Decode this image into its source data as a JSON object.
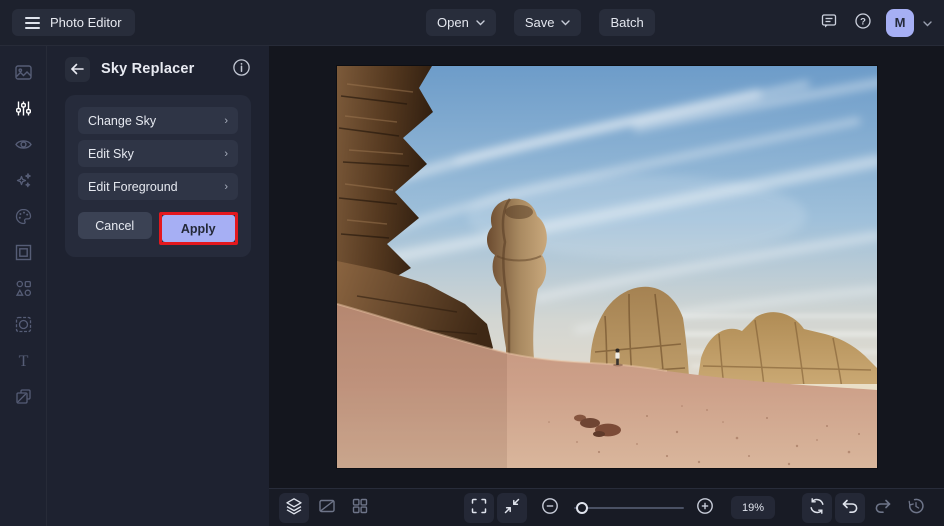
{
  "colors": {
    "accent": "#a6aff4",
    "annotation_red": "#e3181e",
    "topbar_bg": "#1d212d",
    "panel_bg": "#1e2230",
    "canvas_bg": "#14161e"
  },
  "topbar": {
    "app_button": "Photo Editor",
    "open_label": "Open",
    "save_label": "Save",
    "batch_label": "Batch",
    "avatar_initial": "M",
    "icons": [
      "hamburger-icon",
      "chat-feedback-icon",
      "help-icon",
      "chevron-down-icon"
    ]
  },
  "sidebar": {
    "items": [
      {
        "icon": "photo-icon",
        "active": false
      },
      {
        "icon": "sliders-icon",
        "active": true
      },
      {
        "icon": "eye-icon",
        "active": false
      },
      {
        "icon": "sparkles-icon",
        "active": false
      },
      {
        "icon": "palette-icon",
        "active": false
      },
      {
        "icon": "frame-icon",
        "active": false
      },
      {
        "icon": "shapes-icon",
        "active": false
      },
      {
        "icon": "pattern-icon",
        "active": false
      },
      {
        "icon": "text-icon",
        "active": false
      },
      {
        "icon": "layers-icon",
        "active": false
      }
    ]
  },
  "panel": {
    "title": "Sky Replacer",
    "items": [
      {
        "label": "Change Sky"
      },
      {
        "label": "Edit Sky"
      },
      {
        "label": "Edit Foreground"
      }
    ],
    "chevron": "›",
    "cancel_label": "Cancel",
    "apply_label": "Apply",
    "apply_annotated": true
  },
  "canvas": {
    "description": "Desert landscape photo: dark sandstone cliff on the left, a mushroom-shaped rock pillar in the center, golden layered rock formations on the right, pink sand dune in the foreground with a lone person and scattered rocks, under a blue sky with wispy white clouds."
  },
  "toolbar": {
    "zoom_level": "19%",
    "icons_left": [
      "layers-stack-icon",
      "compare-icon",
      "grid-icon"
    ],
    "icons_center": [
      "fullscreen-icon",
      "fit-screen-icon",
      "zoom-out-icon",
      "zoom-slider",
      "zoom-in-icon"
    ],
    "icons_right": [
      "sync-icon",
      "undo-icon",
      "redo-icon",
      "history-icon"
    ]
  }
}
